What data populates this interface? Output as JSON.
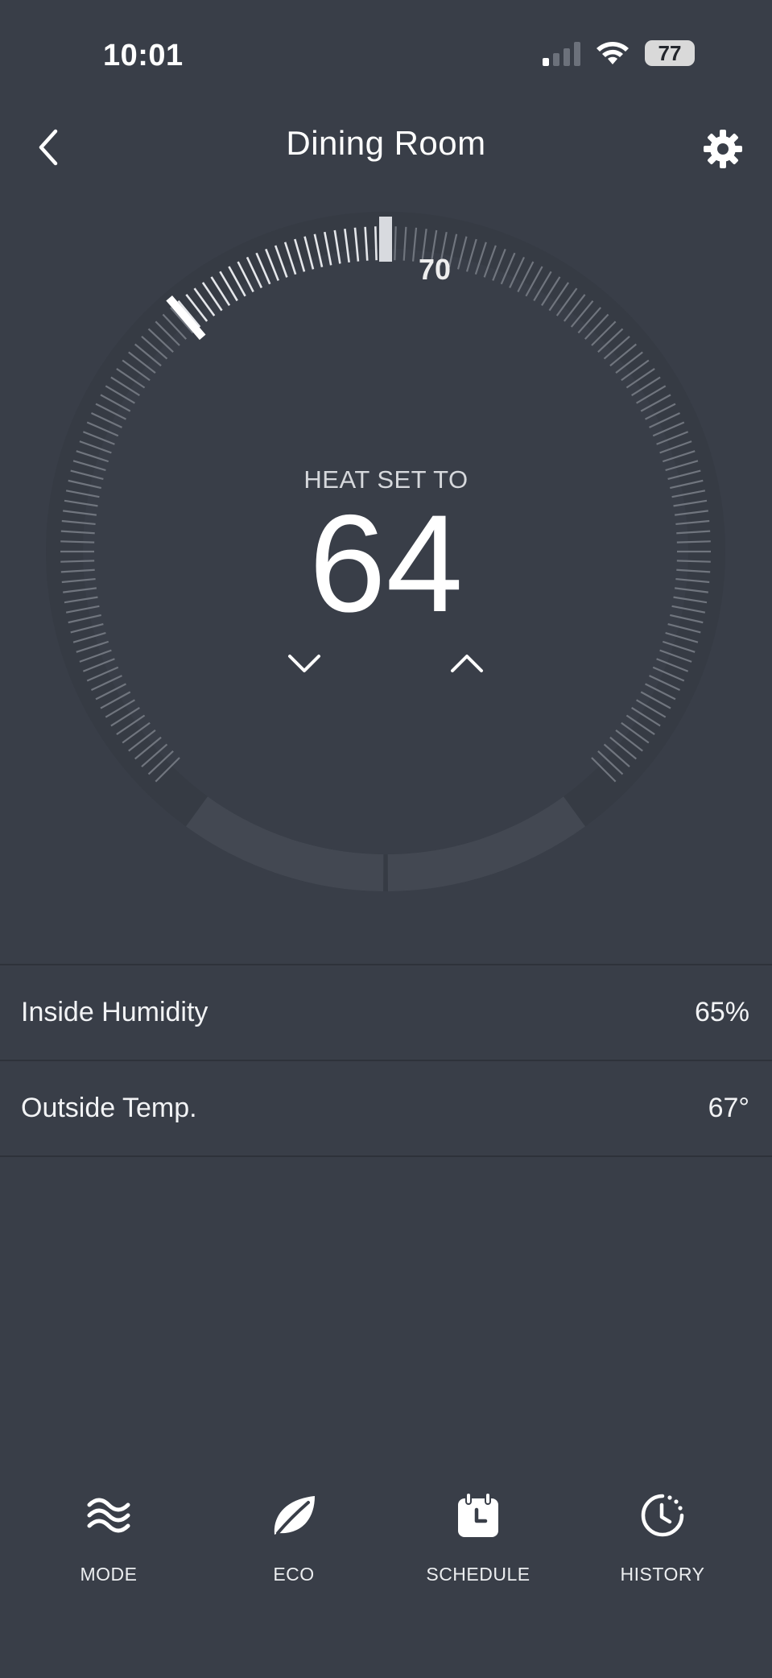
{
  "status_bar": {
    "time": "10:01",
    "battery": "77"
  },
  "header": {
    "title": "Dining Room"
  },
  "thermostat": {
    "mode_label": "HEAT SET TO",
    "setpoint": "64",
    "current_temp": "70",
    "scale_min": 50,
    "scale_max": 90,
    "setpoint_value": 64,
    "current_value": 70
  },
  "info_rows": [
    {
      "label": "Inside Humidity",
      "value": "65%"
    },
    {
      "label": "Outside Temp.",
      "value": "67°"
    }
  ],
  "bottom_nav": {
    "items": [
      {
        "label": "MODE",
        "icon": "heat-waves-icon"
      },
      {
        "label": "ECO",
        "icon": "leaf-icon"
      },
      {
        "label": "SCHEDULE",
        "icon": "calendar-clock-icon"
      },
      {
        "label": "HISTORY",
        "icon": "history-clock-icon"
      }
    ]
  },
  "colors": {
    "background": "#393e48",
    "dial_ring": "#353a43",
    "tick_active": "#e4e6ea",
    "tick_inactive": "#70757e",
    "button_fill": "#434852"
  }
}
